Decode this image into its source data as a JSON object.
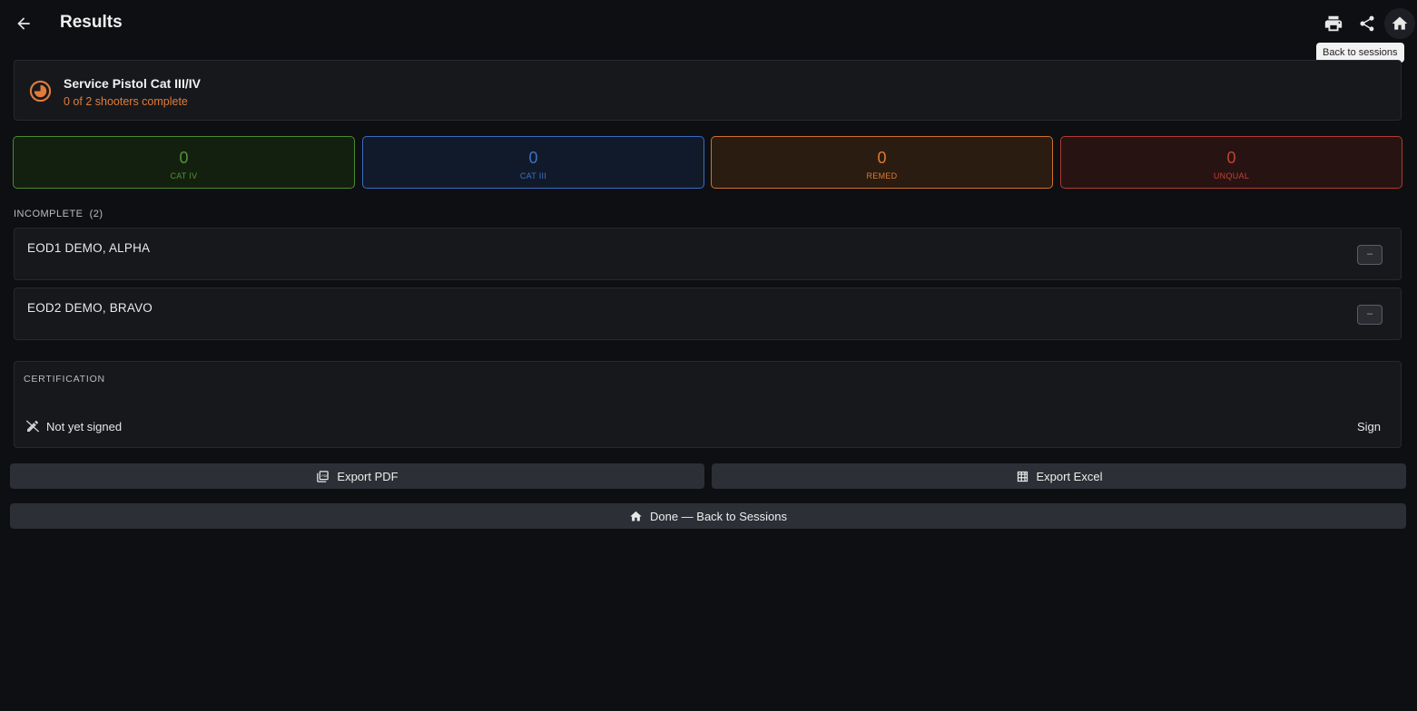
{
  "header": {
    "title": "Results",
    "tooltip": "Back to sessions",
    "icons": [
      "arrow-back-icon",
      "print-icon",
      "share-icon",
      "home-icon"
    ]
  },
  "session": {
    "name": "Service Pistol Cat III/IV",
    "progress": "0 of 2 shooters complete",
    "accent": "#e07b3a"
  },
  "stats": [
    {
      "value": "0",
      "label": "CAT IV",
      "color": "#4f9438"
    },
    {
      "value": "0",
      "label": "CAT III",
      "color": "#3e70c4"
    },
    {
      "value": "0",
      "label": "REMED",
      "color": "#df7a33"
    },
    {
      "value": "0",
      "label": "UNQUAL",
      "color": "#c2432f"
    }
  ],
  "incomplete": {
    "label": "INCOMPLETE",
    "count": "(2)",
    "shooters": [
      {
        "name": "EOD1 DEMO, ALPHA",
        "status": "–"
      },
      {
        "name": "EOD2 DEMO, BRAVO",
        "status": "–"
      }
    ]
  },
  "certification": {
    "label": "CERTIFICATION",
    "status": "Not yet signed",
    "sign_label": "Sign"
  },
  "actions": {
    "export_pdf": "Export PDF",
    "export_excel": "Export Excel",
    "done": "Done — Back to Sessions"
  }
}
